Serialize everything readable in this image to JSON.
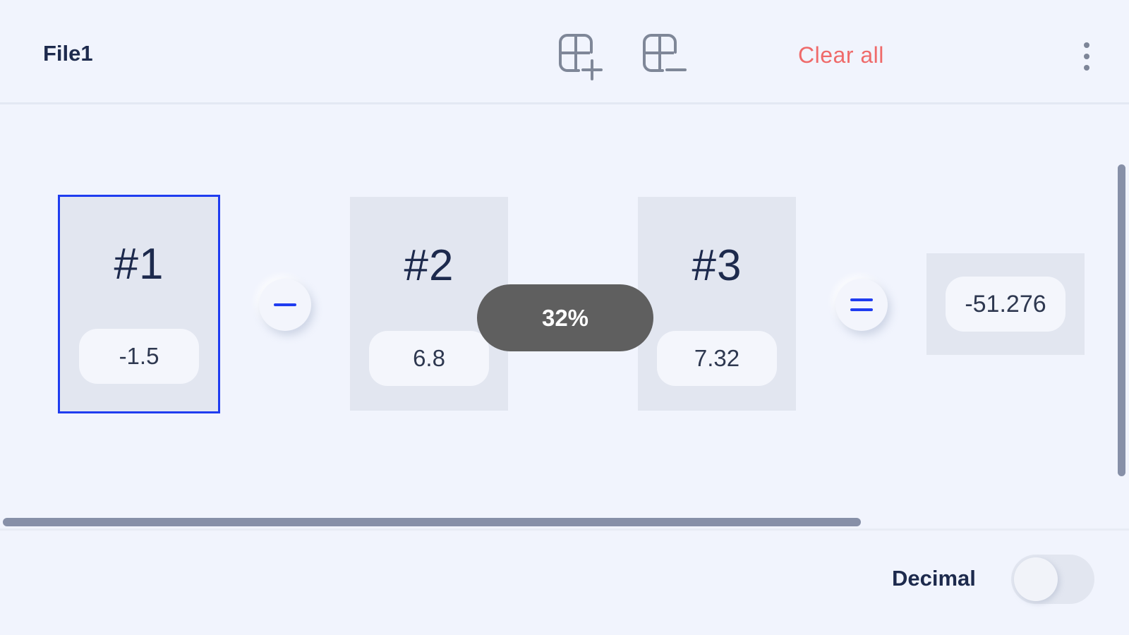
{
  "header": {
    "title": "File1",
    "add_icon": "grid-plus-icon",
    "remove_icon": "grid-minus-icon",
    "clear_label": "Clear all",
    "more_icon": "more-vertical-icon"
  },
  "operands": [
    {
      "label": "#1",
      "value": "-1.5",
      "selected": true
    },
    {
      "label": "#2",
      "value": "6.8",
      "selected": false
    },
    {
      "label": "#3",
      "value": "7.32",
      "selected": false
    }
  ],
  "operators": [
    {
      "symbol": "minus",
      "icon": "minus-icon"
    },
    {
      "symbol": "equals",
      "icon": "equals-icon"
    }
  ],
  "result": {
    "value": "-51.276"
  },
  "zoom_toast": {
    "label": "32%"
  },
  "footer": {
    "decimal_label": "Decimal",
    "decimal_enabled": false
  },
  "colors": {
    "accent": "#1f3cf0",
    "danger": "#ef6a6a",
    "background": "#f1f4fd",
    "card": "#e2e6f0"
  }
}
